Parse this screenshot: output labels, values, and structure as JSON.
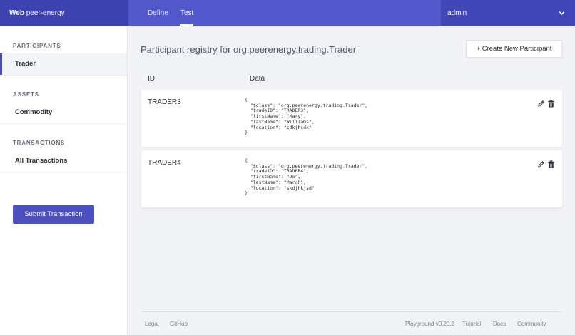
{
  "app": {
    "brand_bold": "Web",
    "brand_rest": " peer-energy"
  },
  "nav": {
    "tabs": [
      "Define",
      "Test"
    ],
    "active": "Test"
  },
  "user": {
    "name": "admin"
  },
  "sidebar": {
    "sections": [
      {
        "heading": "PARTICIPANTS",
        "items": [
          "Trader"
        ]
      },
      {
        "heading": "ASSETS",
        "items": [
          "Commodity"
        ]
      },
      {
        "heading": "TRANSACTIONS",
        "items": [
          "All Transactions"
        ]
      }
    ],
    "active_item": "Trader",
    "submit_label": "Submit Transaction"
  },
  "main": {
    "title": "Participant registry for org.peerenergy.trading.Trader",
    "create_label": "+ Create New Participant",
    "columns": [
      "ID",
      "Data"
    ],
    "rows": [
      {
        "id": "TRADER3",
        "data": "{\n  \"$class\": \"org.peerenergy.trading.Trader\",\n  \"tradeID\": \"TRADER3\",\n  \"firstName\": \"Mary\",\n  \"lastName\": \"Williams\",\n  \"location\": \"sdkjhsdk\"\n}"
      },
      {
        "id": "TRADER4",
        "data": "{\n  \"$class\": \"org.peerenergy.trading.Trader\",\n  \"tradeID\": \"TRADER4\",\n  \"firstName\": \"Jo\",\n  \"lastName\": \"March\",\n  \"location\": \"skdjhkjsd\"\n}"
      }
    ]
  },
  "footer": {
    "left": [
      "Legal",
      "GitHub"
    ],
    "right": [
      "Playground v0.20.2",
      "Tutorial",
      "Docs",
      "Community"
    ]
  },
  "colors": {
    "primary": "#4a4fc0",
    "header_dark": "#3e43b2",
    "background": "#f2f3f7"
  }
}
